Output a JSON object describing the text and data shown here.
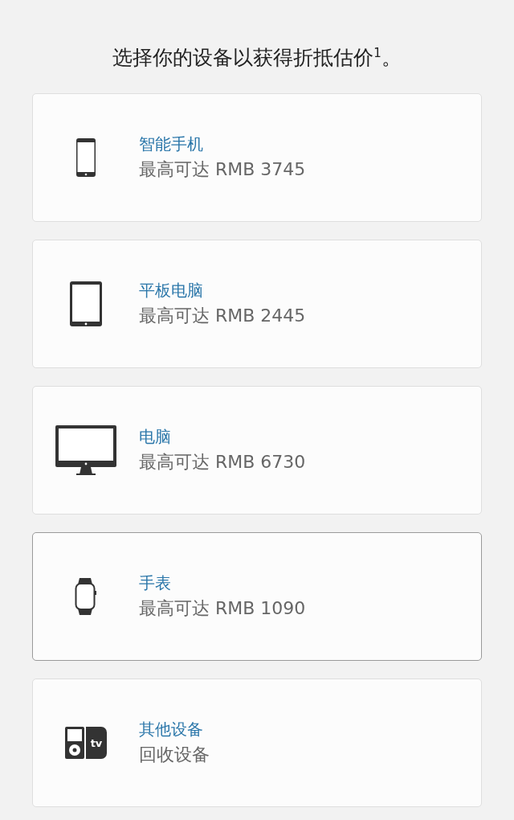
{
  "heading": "选择你的设备以获得折抵估价$^{1}$。",
  "devices": [
    {
      "kind": "phone",
      "name": "智能手机",
      "detail": "最高可达 RMB 3745",
      "selected": false
    },
    {
      "kind": "tablet",
      "name": "平板电脑",
      "detail": "最高可达 RMB 2445",
      "selected": false
    },
    {
      "kind": "desktop",
      "name": "电脑",
      "detail": "最高可达 RMB 6730",
      "selected": false
    },
    {
      "kind": "watch",
      "name": "手表",
      "detail": "最高可达 RMB 1090",
      "selected": true
    },
    {
      "kind": "other",
      "name": "其他设备",
      "detail": "回收设备",
      "selected": false,
      "icon_text": "tv"
    }
  ]
}
